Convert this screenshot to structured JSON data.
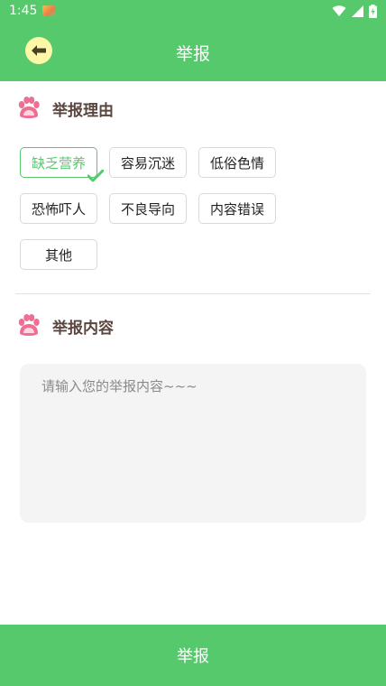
{
  "status_bar": {
    "time": "1:45",
    "battery_icon": "battery-charging-icon",
    "wifi_icon": "wifi-icon",
    "signal_icon": "signal-icon"
  },
  "header": {
    "title": "举报",
    "back_icon": "arrow-left-icon"
  },
  "reasons_section": {
    "title": "举报理由",
    "icon": "paw-icon",
    "tags": [
      {
        "label": "缺乏营养",
        "selected": true
      },
      {
        "label": "容易沉迷",
        "selected": false
      },
      {
        "label": "低俗色情",
        "selected": false
      },
      {
        "label": "恐怖吓人",
        "selected": false
      },
      {
        "label": "不良导向",
        "selected": false
      },
      {
        "label": "内容错误",
        "selected": false
      },
      {
        "label": "其他",
        "selected": false
      }
    ]
  },
  "content_section": {
    "title": "举报内容",
    "icon": "paw-icon",
    "placeholder": "请输入您的举报内容~~~"
  },
  "submit": {
    "label": "举报"
  },
  "colors": {
    "primary": "#55c96b",
    "title_text": "#5a463f",
    "paw": "#ee6f94",
    "back_bg": "#fff7a8"
  }
}
